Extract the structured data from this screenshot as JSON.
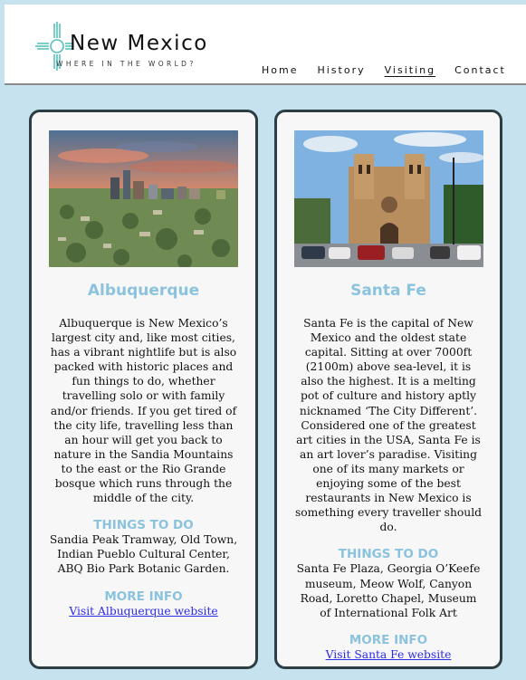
{
  "header": {
    "brand": "New Mexico",
    "tagline": "WHERE IN THE WORLD?",
    "nav": [
      "Home",
      "History",
      "Visiting",
      "Contact"
    ],
    "active_nav": "Visiting"
  },
  "colors": {
    "page_bg": "#c5e2ee",
    "accent": "#8bc3de",
    "link": "#2b2be8",
    "card_border": "#2c3d44"
  },
  "cards": [
    {
      "city": "Albuquerque",
      "description": "Albuquerque is New Mexico’s largest city and, like most cities, has a vibrant nightlife but is also packed with historic places and fun things to do, whether travelling solo or with family and/or friends. If you get tired of the city life, travelling less than an hour will get you back to nature in the Sandia Mountains to the east or the Rio Grande bosque which runs through the middle of the city.",
      "things_heading": "THINGS TO DO",
      "things": "Sandia Peak Tramway, Old Town, Indian Pueblo Cultural Center, ABQ Bio Park Botanic Garden.",
      "more_heading": "MORE INFO",
      "link_text": "Visit Albuquerque website"
    },
    {
      "city": "Santa Fe",
      "description": "Santa Fe is the capital of New Mexico and the oldest state capital. Sitting at over 7000ft (2100m) above sea-level, it is also the highest. It is a melting pot of culture and history aptly nicknamed ‘The City Different’. Considered one of the greatest art cities in the USA, Santa Fe is an art lover’s paradise. Visiting one of its many markets or enjoying some of the best restaurants in New Mexico is something every traveller should do.",
      "things_heading": "THINGS TO DO",
      "things": "Santa Fe Plaza, Georgia O’Keefe museum, Meow Wolf, Canyon Road, Loretto Chapel, Museum of International Folk Art",
      "more_heading": "MORE INFO",
      "link_text": "Visit Santa Fe website"
    }
  ]
}
